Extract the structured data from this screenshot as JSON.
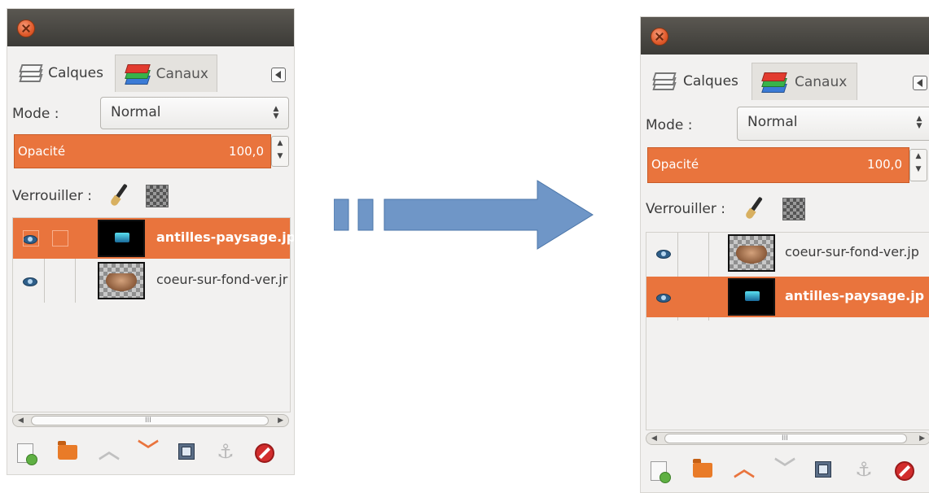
{
  "panels": {
    "before": {
      "tabs": {
        "layers": "Calques",
        "channels": "Canaux"
      },
      "mode_label": "Mode :",
      "mode_value": "Normal",
      "opacity_label": "Opacité",
      "opacity_value": "100,0",
      "lock_label": "Verrouiller :",
      "layers": [
        {
          "name": "antilles-paysage.jp",
          "selected": true
        },
        {
          "name": "coeur-sur-fond-ver.jr",
          "selected": false
        }
      ],
      "scroll_grip": "III"
    },
    "after": {
      "tabs": {
        "layers": "Calques",
        "channels": "Canaux"
      },
      "mode_label": "Mode :",
      "mode_value": "Normal",
      "opacity_label": "Opacité",
      "opacity_value": "100,0",
      "lock_label": "Verrouiller :",
      "layers": [
        {
          "name": "coeur-sur-fond-ver.jp",
          "selected": false
        },
        {
          "name": "antilles-paysage.jp",
          "selected": true
        }
      ],
      "scroll_grip": "III"
    }
  },
  "colors": {
    "selection_orange": "#e9743d",
    "arrow_blue": "#6f96c7",
    "titlebar": "#3c3b37"
  },
  "icons": [
    "close-icon",
    "layers-icon",
    "channels-icon",
    "tab-menu-icon",
    "paintbrush-icon",
    "checkerboard-icon",
    "eye-icon",
    "new-layer-icon",
    "new-group-icon",
    "raise-layer-icon",
    "lower-layer-icon",
    "duplicate-layer-icon",
    "anchor-icon",
    "delete-layer-icon"
  ]
}
